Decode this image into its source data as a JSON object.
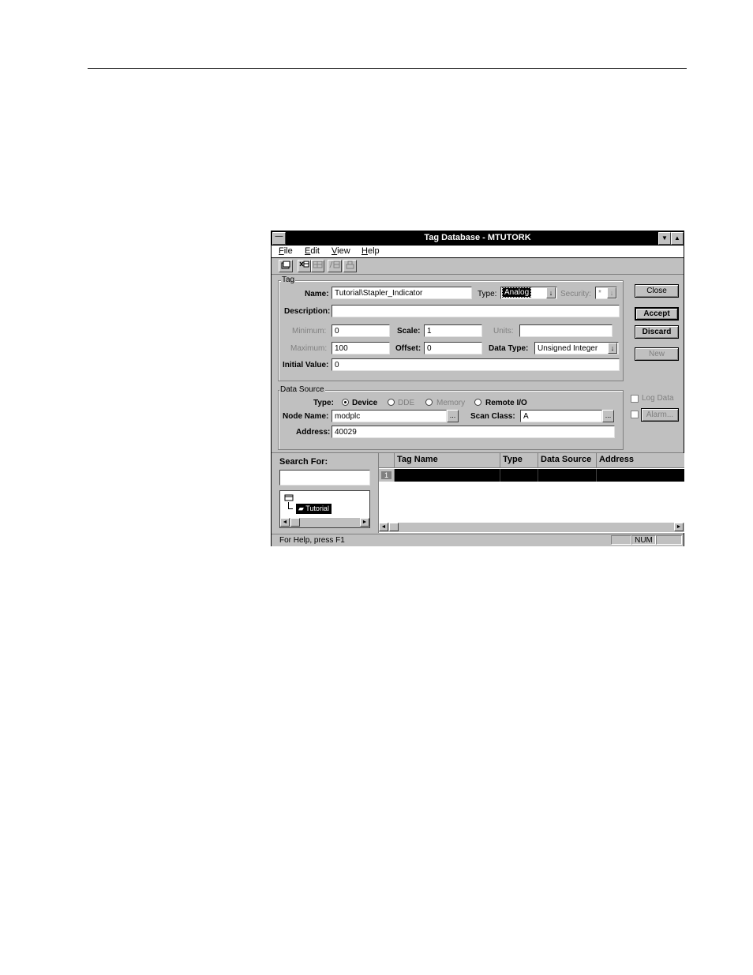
{
  "window": {
    "title": "Tag Database - MTUTORK",
    "minimize_glyph": "▼",
    "maximize_glyph": "▲",
    "system_menu_glyph": "—"
  },
  "menu": [
    "File",
    "Edit",
    "View",
    "Help"
  ],
  "toolbar": {
    "icons": [
      "open-folder-icon",
      "delete-tag-icon",
      "grid-icon",
      "table-icon",
      "print-icon"
    ]
  },
  "tag": {
    "group_label": "Tag",
    "name_label": "Name:",
    "name_value": "Tutorial\\Stapler_Indicator",
    "type_label": "Type:",
    "type_value": "Analog",
    "security_label": "Security:",
    "security_value": "*",
    "description_label": "Description:",
    "description_value": "",
    "minimum_label": "Minimum:",
    "minimum_value": "0",
    "scale_label": "Scale:",
    "scale_value": "1",
    "units_label": "Units:",
    "units_value": "",
    "maximum_label": "Maximum:",
    "maximum_value": "100",
    "offset_label": "Offset:",
    "offset_value": "0",
    "data_type_label": "Data Type:",
    "data_type_value": "Unsigned Integer",
    "initial_value_label": "Initial Value:",
    "initial_value_value": "0"
  },
  "buttons": {
    "close": "Close",
    "accept": "Accept",
    "discard": "Discard",
    "new": "New",
    "alarm": "Alarm...",
    "ellipsis": "..."
  },
  "data_source": {
    "group_label": "Data Source",
    "type_label": "Type:",
    "options": [
      "Device",
      "DDE",
      "Memory",
      "Remote I/O"
    ],
    "selected": "Device",
    "node_name_label": "Node Name:",
    "node_name_value": "modplc",
    "scan_class_label": "Scan Class:",
    "scan_class_value": "A",
    "address_label": "Address:",
    "address_value": "40029",
    "log_data_label": "Log Data"
  },
  "search": {
    "label": "Search For:",
    "value": "",
    "tree_item": "Tutorial"
  },
  "grid": {
    "columns": [
      "Tag Name",
      "Type",
      "Data Source",
      "Address"
    ],
    "rows": [
      {
        "num": "1",
        "tag_name": "",
        "type": "",
        "data_source": "",
        "address": ""
      }
    ]
  },
  "status": {
    "message": "For Help, press F1",
    "num": "NUM"
  }
}
